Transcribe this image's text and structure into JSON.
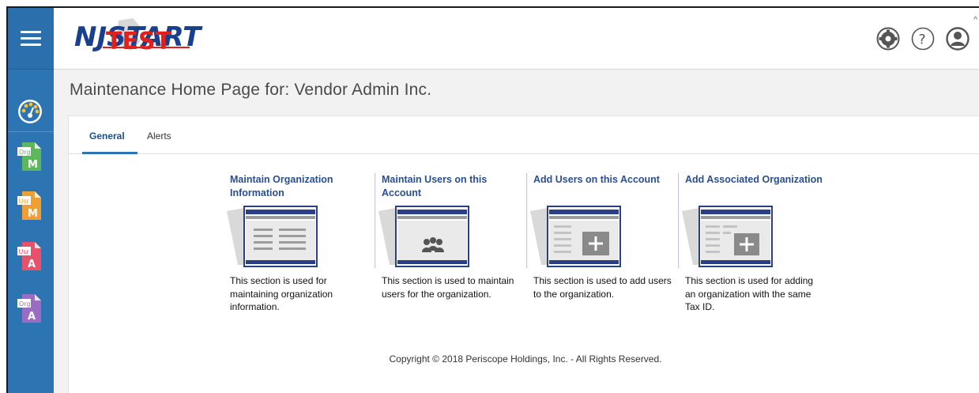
{
  "header": {
    "logo_text": "NJSTART",
    "logo_overlay": "TEST",
    "settings_label": "Settings",
    "help_label": "Help",
    "user_label": "User"
  },
  "sidebar": {
    "items": [
      {
        "icon": "dashboard-icon"
      },
      {
        "top": "Org",
        "bottom": "M",
        "color": "#5cb85c"
      },
      {
        "top": "Usr",
        "bottom": "M",
        "color": "#f0a030"
      },
      {
        "top": "Usr",
        "bottom": "A",
        "color": "#e8506c"
      },
      {
        "top": "Org",
        "bottom": "A",
        "color": "#9b6cc4"
      }
    ]
  },
  "page": {
    "title": "Maintenance Home Page for: Vendor Admin Inc."
  },
  "tabs": [
    {
      "label": "General",
      "active": true
    },
    {
      "label": "Alerts",
      "active": false
    }
  ],
  "tiles": [
    {
      "title": "Maintain Organization Information",
      "description": "This section is used for maintaining organization information.",
      "image": "org-info-image"
    },
    {
      "title": "Maintain Users on this Account",
      "description": "This section is used to maintain users for the organization.",
      "image": "users-image"
    },
    {
      "title": "Add Users on this Account",
      "description": "This section is used to add users to the organization.",
      "image": "add-users-image"
    },
    {
      "title": "Add Associated Organization",
      "description": "This section is used for adding an organization with the same Tax ID.",
      "image": "add-org-image"
    }
  ],
  "footer": {
    "copyright": "Copyright © 2018 Periscope Holdings, Inc. - All Rights Reserved."
  },
  "colors": {
    "sidebar": "#2d74b2",
    "tile_title": "#2a4f8e",
    "tab_active": "#1c4f82"
  }
}
